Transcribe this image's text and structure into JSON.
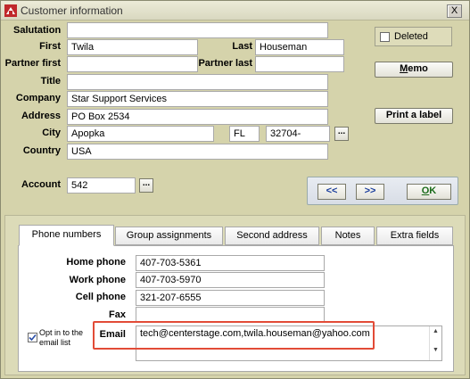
{
  "window": {
    "title": "Customer information",
    "close_label": "X",
    "app_icon": "red-app-icon"
  },
  "labels": {
    "salutation": "Salutation",
    "first": "First",
    "last": "Last",
    "partner_first": "Partner first",
    "partner_last": "Partner last",
    "title": "Title",
    "company": "Company",
    "address": "Address",
    "city": "City",
    "country": "Country",
    "account": "Account"
  },
  "fields": {
    "salutation": "",
    "first": "Twila",
    "last": "Houseman",
    "partner_first": "",
    "partner_last": "",
    "title": "",
    "company": "Star Support Services",
    "address": "PO Box 2534",
    "city": "Apopka",
    "state": "FL",
    "zip": "32704-",
    "country": "USA",
    "account": "542"
  },
  "buttons": {
    "deleted_label": "Deleted",
    "memo_prefix": "M",
    "memo_rest": "emo",
    "print_label": "Print a label",
    "prev_label": "<<",
    "next_label": ">>",
    "ok_prefix": "O",
    "ok_rest": "K",
    "ellipsis": "..."
  },
  "tabs": [
    {
      "label": "Phone numbers",
      "active": true
    },
    {
      "label": "Group assignments",
      "active": false
    },
    {
      "label": "Second address",
      "active": false
    },
    {
      "label": "Notes",
      "active": false
    },
    {
      "label": "Extra fields",
      "active": false
    }
  ],
  "phone": {
    "home_label": "Home phone",
    "home": "407-703-5361",
    "work_label": "Work phone",
    "work": "407-703-5970",
    "cell_label": "Cell phone",
    "cell": "321-207-6555",
    "fax_label": "Fax",
    "fax": "",
    "email_label": "Email",
    "email": "tech@centerstage.com,twila.houseman@yahoo.com",
    "optin_line1": "Opt in to the",
    "optin_line2": "email list",
    "optin_checked": true
  },
  "colors": {
    "background": "#d5d3ab",
    "highlight": "#e24b37",
    "nav_text": "#1a3d9c"
  }
}
